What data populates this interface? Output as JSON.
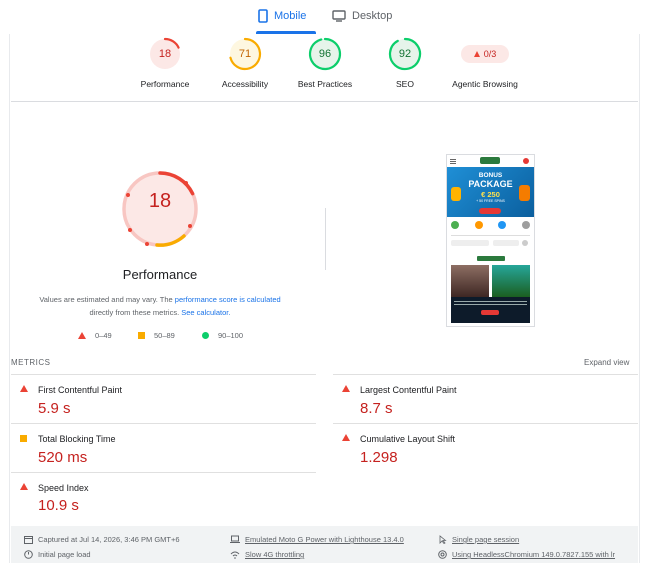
{
  "tabs": {
    "mobile": "Mobile",
    "desktop": "Desktop"
  },
  "scores": [
    {
      "value": "18",
      "label": "Performance",
      "color": "#c5221f",
      "stroke": "#eb4335",
      "fill": "#fce8e6",
      "fraction": 0.18
    },
    {
      "value": "71",
      "label": "Accessibility",
      "color": "#c26401",
      "stroke": "#f9ab00",
      "fill": "#fef7e0",
      "fraction": 0.71
    },
    {
      "value": "96",
      "label": "Best Practices",
      "color": "#137333",
      "stroke": "#0cce6b",
      "fill": "#e6f4ea",
      "fraction": 0.96
    },
    {
      "value": "92",
      "label": "SEO",
      "color": "#137333",
      "stroke": "#0cce6b",
      "fill": "#e6f4ea",
      "fraction": 0.92
    }
  ],
  "agentic": {
    "value": "0/3",
    "label": "Agentic Browsing"
  },
  "performance": {
    "score": "18",
    "title": "Performance",
    "desc_prefix": "Values are estimated and may vary. The ",
    "desc_link1": "performance score is calculated",
    "desc_mid": "directly from these metrics. ",
    "desc_link2": "See calculator.",
    "legend": {
      "fail": "0–49",
      "average": "50–89",
      "pass": "90–100"
    }
  },
  "thumbnail": {
    "promo_line1": "BONUS",
    "promo_line2": "PACKAGE",
    "promo_amount": "€ 250",
    "promo_sub": "+ 50 FREE SPINS"
  },
  "metrics_header": "METRICS",
  "expand_label": "Expand view",
  "metrics": {
    "fcp": {
      "name": "First Contentful Paint",
      "value": "5.9 s"
    },
    "lcp": {
      "name": "Largest Contentful Paint",
      "value": "8.7 s"
    },
    "tbt": {
      "name": "Total Blocking Time",
      "value": "520 ms"
    },
    "cls": {
      "name": "Cumulative Layout Shift",
      "value": "1.298"
    },
    "si": {
      "name": "Speed Index",
      "value": "10.9 s"
    }
  },
  "footer": {
    "captured": "Captured at Jul 14, 2026, 3:46 PM GMT+6",
    "load": "Initial page load",
    "device": "Emulated Moto G Power with Lighthouse 13.4.0",
    "throttle": "Slow 4G throttling",
    "session": "Single page session",
    "browser": "Using HeadlessChromium 149.0.7827.155 with lr"
  },
  "colors": {
    "accent": "#1a73e8",
    "fail": "#eb4335",
    "average": "#f9ab00",
    "pass": "#0cce6b"
  }
}
